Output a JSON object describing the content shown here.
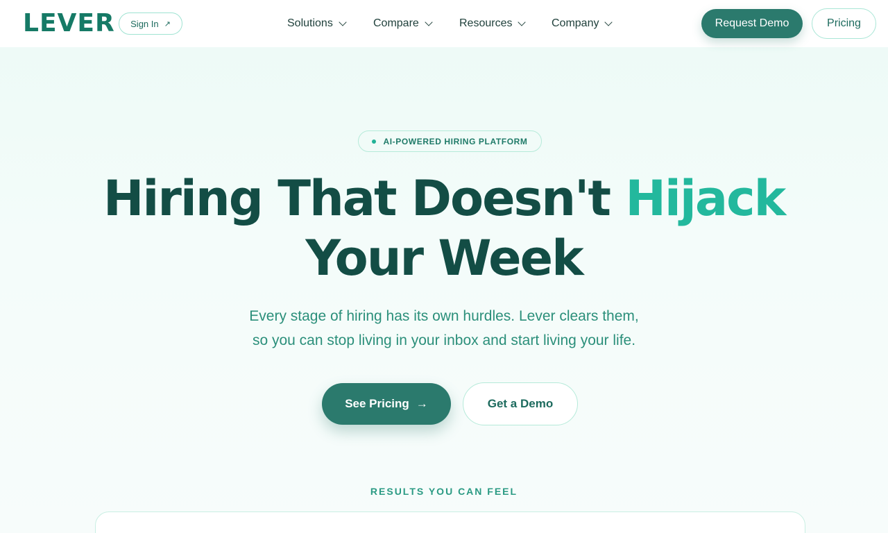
{
  "nav": {
    "logo": "LEVER",
    "sign_in": "Sign In",
    "sign_in_icon": "arrow-up-right-icon",
    "menu": [
      {
        "label": "Solutions"
      },
      {
        "label": "Compare"
      },
      {
        "label": "Resources"
      },
      {
        "label": "Company"
      }
    ],
    "request_demo": "Request Demo",
    "pricing": "Pricing"
  },
  "hero": {
    "badge": "AI-POWERED HIRING PLATFORM",
    "headline_part1": "Hiring That Doesn't ",
    "headline_accent": "Hijack",
    "headline_part2": "Your Week",
    "subtitle_line1": "Every stage of hiring has its own hurdles. Lever clears them,",
    "subtitle_line2": "so you can stop living in your inbox and start living your life.",
    "see_pricing": "See Pricing",
    "see_pricing_arrow": "→",
    "get_demo": "Get a Demo"
  },
  "results": {
    "heading": "RESULTS YOU CAN FEEL"
  },
  "colors": {
    "brand": "#167a66",
    "button": "#2b7a6d",
    "accent": "#23b89d",
    "headline": "#134d45"
  }
}
